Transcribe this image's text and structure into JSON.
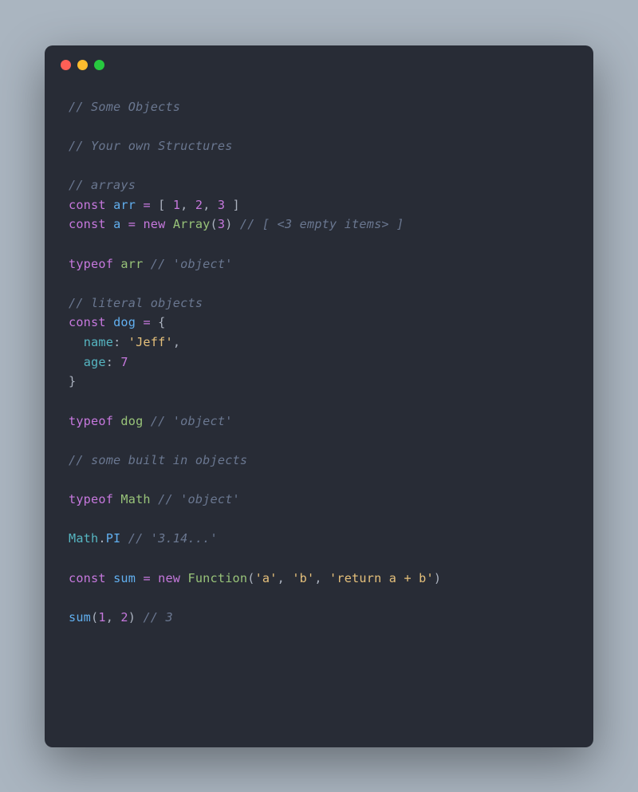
{
  "colors": {
    "background": "#aab5c0",
    "editor_bg": "#282c36",
    "dot_red": "#ff5f56",
    "dot_yellow": "#ffbd2e",
    "dot_green": "#27c93f"
  },
  "code": {
    "tokens": [
      [
        {
          "t": "// Some Objects",
          "c": "comment"
        }
      ],
      [],
      [
        {
          "t": "// Your own Structures",
          "c": "comment"
        }
      ],
      [],
      [
        {
          "t": "// arrays",
          "c": "comment"
        }
      ],
      [
        {
          "t": "const",
          "c": "keyword"
        },
        {
          "t": " ",
          "c": "punct"
        },
        {
          "t": "arr",
          "c": "var"
        },
        {
          "t": " ",
          "c": "punct"
        },
        {
          "t": "=",
          "c": "operator"
        },
        {
          "t": " [ ",
          "c": "punct"
        },
        {
          "t": "1",
          "c": "number"
        },
        {
          "t": ", ",
          "c": "punct"
        },
        {
          "t": "2",
          "c": "number"
        },
        {
          "t": ", ",
          "c": "punct"
        },
        {
          "t": "3",
          "c": "number"
        },
        {
          "t": " ]",
          "c": "punct"
        }
      ],
      [
        {
          "t": "const",
          "c": "keyword"
        },
        {
          "t": " ",
          "c": "punct"
        },
        {
          "t": "a",
          "c": "var"
        },
        {
          "t": " ",
          "c": "punct"
        },
        {
          "t": "=",
          "c": "operator"
        },
        {
          "t": " ",
          "c": "punct"
        },
        {
          "t": "new",
          "c": "keyword"
        },
        {
          "t": " ",
          "c": "punct"
        },
        {
          "t": "Array",
          "c": "class"
        },
        {
          "t": "(",
          "c": "punct"
        },
        {
          "t": "3",
          "c": "number"
        },
        {
          "t": ") ",
          "c": "punct"
        },
        {
          "t": "// [ <3 empty items> ]",
          "c": "comment"
        }
      ],
      [],
      [
        {
          "t": "typeof",
          "c": "keyword"
        },
        {
          "t": " ",
          "c": "punct"
        },
        {
          "t": "arr",
          "c": "class"
        },
        {
          "t": " ",
          "c": "punct"
        },
        {
          "t": "// 'object'",
          "c": "comment"
        }
      ],
      [],
      [
        {
          "t": "// literal objects",
          "c": "comment"
        }
      ],
      [
        {
          "t": "const",
          "c": "keyword"
        },
        {
          "t": " ",
          "c": "punct"
        },
        {
          "t": "dog",
          "c": "var"
        },
        {
          "t": " ",
          "c": "punct"
        },
        {
          "t": "=",
          "c": "operator"
        },
        {
          "t": " {",
          "c": "punct"
        }
      ],
      [
        {
          "t": "  ",
          "c": "punct"
        },
        {
          "t": "name",
          "c": "prop"
        },
        {
          "t": ": ",
          "c": "punct"
        },
        {
          "t": "'Jeff'",
          "c": "string"
        },
        {
          "t": ",",
          "c": "punct"
        }
      ],
      [
        {
          "t": "  ",
          "c": "punct"
        },
        {
          "t": "age",
          "c": "prop"
        },
        {
          "t": ": ",
          "c": "punct"
        },
        {
          "t": "7",
          "c": "number"
        }
      ],
      [
        {
          "t": "}",
          "c": "punct"
        }
      ],
      [],
      [
        {
          "t": "typeof",
          "c": "keyword"
        },
        {
          "t": " ",
          "c": "punct"
        },
        {
          "t": "dog",
          "c": "class"
        },
        {
          "t": " ",
          "c": "punct"
        },
        {
          "t": "// 'object'",
          "c": "comment"
        }
      ],
      [],
      [
        {
          "t": "// some built in objects",
          "c": "comment"
        }
      ],
      [],
      [
        {
          "t": "typeof",
          "c": "keyword"
        },
        {
          "t": " ",
          "c": "punct"
        },
        {
          "t": "Math",
          "c": "class"
        },
        {
          "t": " ",
          "c": "punct"
        },
        {
          "t": "// 'object'",
          "c": "comment"
        }
      ],
      [],
      [
        {
          "t": "Math",
          "c": "builtin"
        },
        {
          "t": ".",
          "c": "punct"
        },
        {
          "t": "PI",
          "c": "var"
        },
        {
          "t": " ",
          "c": "punct"
        },
        {
          "t": "// '3.14...'",
          "c": "comment"
        }
      ],
      [],
      [
        {
          "t": "const",
          "c": "keyword"
        },
        {
          "t": " ",
          "c": "punct"
        },
        {
          "t": "sum",
          "c": "var"
        },
        {
          "t": " ",
          "c": "punct"
        },
        {
          "t": "=",
          "c": "operator"
        },
        {
          "t": " ",
          "c": "punct"
        },
        {
          "t": "new",
          "c": "keyword"
        },
        {
          "t": " ",
          "c": "punct"
        },
        {
          "t": "Function",
          "c": "class"
        },
        {
          "t": "(",
          "c": "punct"
        },
        {
          "t": "'a'",
          "c": "string"
        },
        {
          "t": ", ",
          "c": "punct"
        },
        {
          "t": "'b'",
          "c": "string"
        },
        {
          "t": ", ",
          "c": "punct"
        },
        {
          "t": "'return a + b'",
          "c": "string"
        },
        {
          "t": ")",
          "c": "punct"
        }
      ],
      [],
      [
        {
          "t": "sum",
          "c": "func"
        },
        {
          "t": "(",
          "c": "punct"
        },
        {
          "t": "1",
          "c": "number"
        },
        {
          "t": ", ",
          "c": "punct"
        },
        {
          "t": "2",
          "c": "number"
        },
        {
          "t": ") ",
          "c": "punct"
        },
        {
          "t": "// 3",
          "c": "comment"
        }
      ]
    ]
  }
}
